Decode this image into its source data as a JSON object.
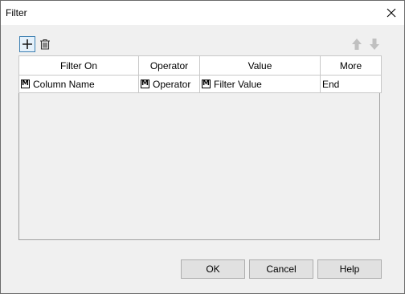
{
  "window": {
    "title": "Filter"
  },
  "icons": {
    "close": "close-icon",
    "add": "plus-icon",
    "delete": "trash-icon",
    "up": "arrow-up-icon",
    "down": "arrow-down-icon",
    "field_type": "m-icon"
  },
  "table": {
    "headers": [
      "Filter On",
      "Operator",
      "Value",
      "More"
    ],
    "rows": [
      {
        "filter_on": "Column Name",
        "operator": "Operator",
        "value": "Filter Value",
        "more": "End",
        "icon_letter": "M"
      }
    ]
  },
  "buttons": {
    "ok": "OK",
    "cancel": "Cancel",
    "help": "Help"
  },
  "colors": {
    "accent": "#3c7fb1",
    "disabled_arrow": "#c0c0c0"
  }
}
